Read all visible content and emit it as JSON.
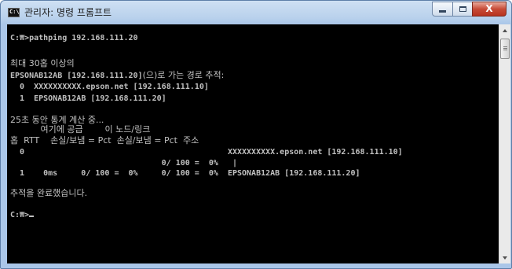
{
  "window": {
    "title": "관리자: 명령 프롬프트",
    "icon_text": "C:\\",
    "icon": "cmd-console-icon",
    "controls": {
      "minimize_icon": "minimize-icon",
      "maximize_icon": "maximize-icon",
      "close_icon": "close-icon",
      "close_glyph": "X"
    }
  },
  "console": {
    "prompt_command": "C:₩>pathping 192.168.111.20",
    "tracing_line1": "최대 30홉 이상의",
    "tracing_line2_host": "EPSONAB12AB [192.168.111.20]",
    "tracing_line2_rest": "(으)로 가는 경로 추적:",
    "route": [
      {
        "hop": "0",
        "host": "XXXXXXXXXX.epson.net [192.168.111.10]"
      },
      {
        "hop": "1",
        "host": "EPSONAB12AB [192.168.111.20]"
      }
    ],
    "computing": "25초 동안 통계 계산 중...",
    "header1": "           여기에 공급        이 노드/링크",
    "header2": "홉  RTT    손실/보냄 = Pct  손실/보냄 = Pct  주소",
    "stats_rows": [
      "  0                                           XXXXXXXXXX.epson.net [192.168.111.10]",
      "                                0/ 100 =  0%   |",
      "  1    0ms     0/ 100 =  0%     0/ 100 =  0%  EPSONAB12AB [192.168.111.20]"
    ],
    "trace_complete": "추적을 완료했습니다.",
    "final_prompt": "C:₩>"
  },
  "colors": {
    "console_background": "#000000",
    "console_text": "#c0c0c0",
    "close_button": "#c74b37"
  }
}
